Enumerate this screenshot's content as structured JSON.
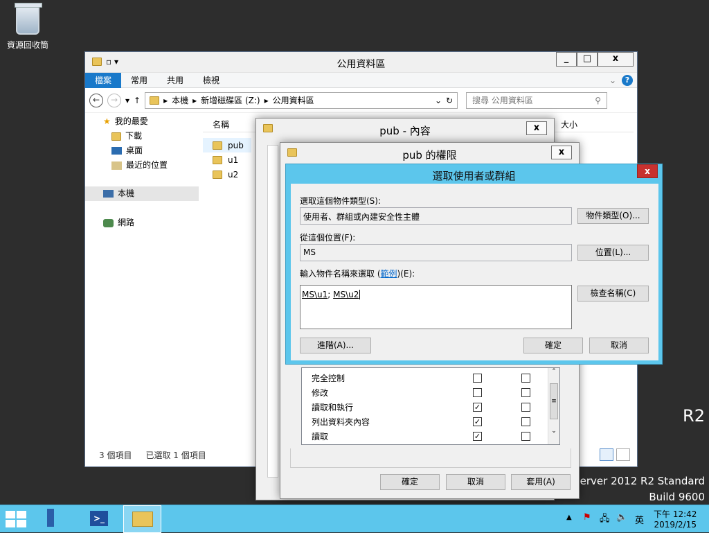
{
  "desktop": {
    "recycle_label": "資源回收筒",
    "os_line1": "R2",
    "os_line2": "Server 2012 R2 Standard",
    "os_line3": "Build 9600"
  },
  "explorer": {
    "title": "公用資料區",
    "tabs": [
      "檔案",
      "常用",
      "共用",
      "檢視"
    ],
    "breadcrumb": [
      "本機",
      "新增磁碟區 (Z:)",
      "公用資料區"
    ],
    "search_placeholder": "搜尋 公用資料區",
    "nav": {
      "favorites": "我的最愛",
      "downloads": "下載",
      "desktop": "桌面",
      "recent": "最近的位置",
      "thispc": "本機",
      "network": "網路"
    },
    "columns": {
      "name": "名稱",
      "size": "大小"
    },
    "files": [
      "pub",
      "u1",
      "u2"
    ],
    "status_count": "3 個項目",
    "status_selected": "已選取 1 個項目"
  },
  "props": {
    "title": "pub - 內容"
  },
  "perm": {
    "title": "pub 的權限",
    "rows": [
      {
        "label": "完全控制",
        "allow": false,
        "deny": false
      },
      {
        "label": "修改",
        "allow": false,
        "deny": false
      },
      {
        "label": "讀取和執行",
        "allow": true,
        "deny": false
      },
      {
        "label": "列出資料夾內容",
        "allow": true,
        "deny": false
      },
      {
        "label": "讀取",
        "allow": true,
        "deny": false
      }
    ],
    "ok": "確定",
    "cancel": "取消",
    "apply": "套用(A)"
  },
  "select": {
    "title": "選取使用者或群組",
    "type_label": "選取這個物件類型(S):",
    "type_value": "使用者、群組或內建安全性主體",
    "type_btn": "物件類型(O)...",
    "loc_label": "從這個位置(F):",
    "loc_value": "MS",
    "loc_btn": "位置(L)...",
    "names_label_pre": "輸入物件名稱來選取 (",
    "names_label_link": "範例",
    "names_label_post": ")(E):",
    "names_value_a": "MS\\u1",
    "names_value_sep": "; ",
    "names_value_b": "MS\\u2",
    "check_btn": "檢查名稱(C)",
    "advanced_btn": "進階(A)...",
    "ok": "確定",
    "cancel": "取消"
  },
  "taskbar": {
    "time": "下午 12:42",
    "date": "2019/2/15",
    "ime": "英"
  },
  "colors": {
    "accent": "#1979ca",
    "taskbar": "#5cc6ec",
    "close_red": "#c7312f"
  }
}
